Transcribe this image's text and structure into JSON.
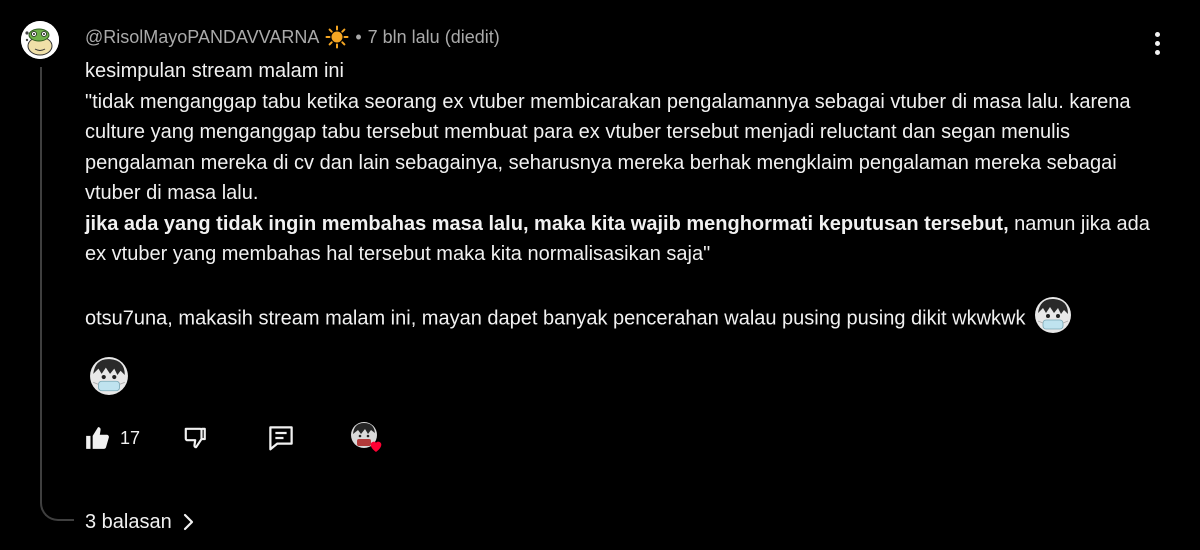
{
  "comment": {
    "author": "@RisolMayoPANDAVVARNA",
    "separator": "•",
    "timestamp": "7 bln lalu (diedit)",
    "body": {
      "line1": "kesimpulan stream malam ini",
      "para1": "\"tidak menganggap tabu ketika seorang ex vtuber membicarakan pengalamannya sebagai vtuber di masa lalu. karena culture yang menganggap tabu tersebut membuat para ex vtuber tersebut menjadi reluctant dan segan menulis pengalaman mereka di cv dan lain sebagainya, seharusnya mereka berhak mengklaim pengalaman mereka sebagai vtuber di masa lalu.",
      "bold_sentence": "jika ada yang tidak ingin membahas masa lalu, maka kita wajib menghormati keputusan tersebut,",
      "para2_tail": " namun jika ada ex vtuber yang membahas hal tersebut maka kita normalisasikan saja\"",
      "para3": "otsu7una, makasih stream malam ini, mayan dapet banyak pencerahan walau pusing pusing dikit wkwkwk"
    },
    "like_count": "17",
    "replies_label": "3 balasan"
  },
  "icons": {
    "author_badge": "sun-emoji-icon",
    "custom_emoji": "masked-character-emoji-icon",
    "like": "thumbs-up-icon",
    "dislike": "thumbs-down-icon",
    "reply": "comment-icon",
    "creator_heart": "creator-heart-icon",
    "more": "more-vert-icon",
    "expand": "chevron-right-icon"
  },
  "colors": {
    "background": "#000000",
    "text": "#f1f1f1",
    "meta": "#aaaaaa",
    "heart": "#ff0033",
    "badge": "#f5a623"
  }
}
